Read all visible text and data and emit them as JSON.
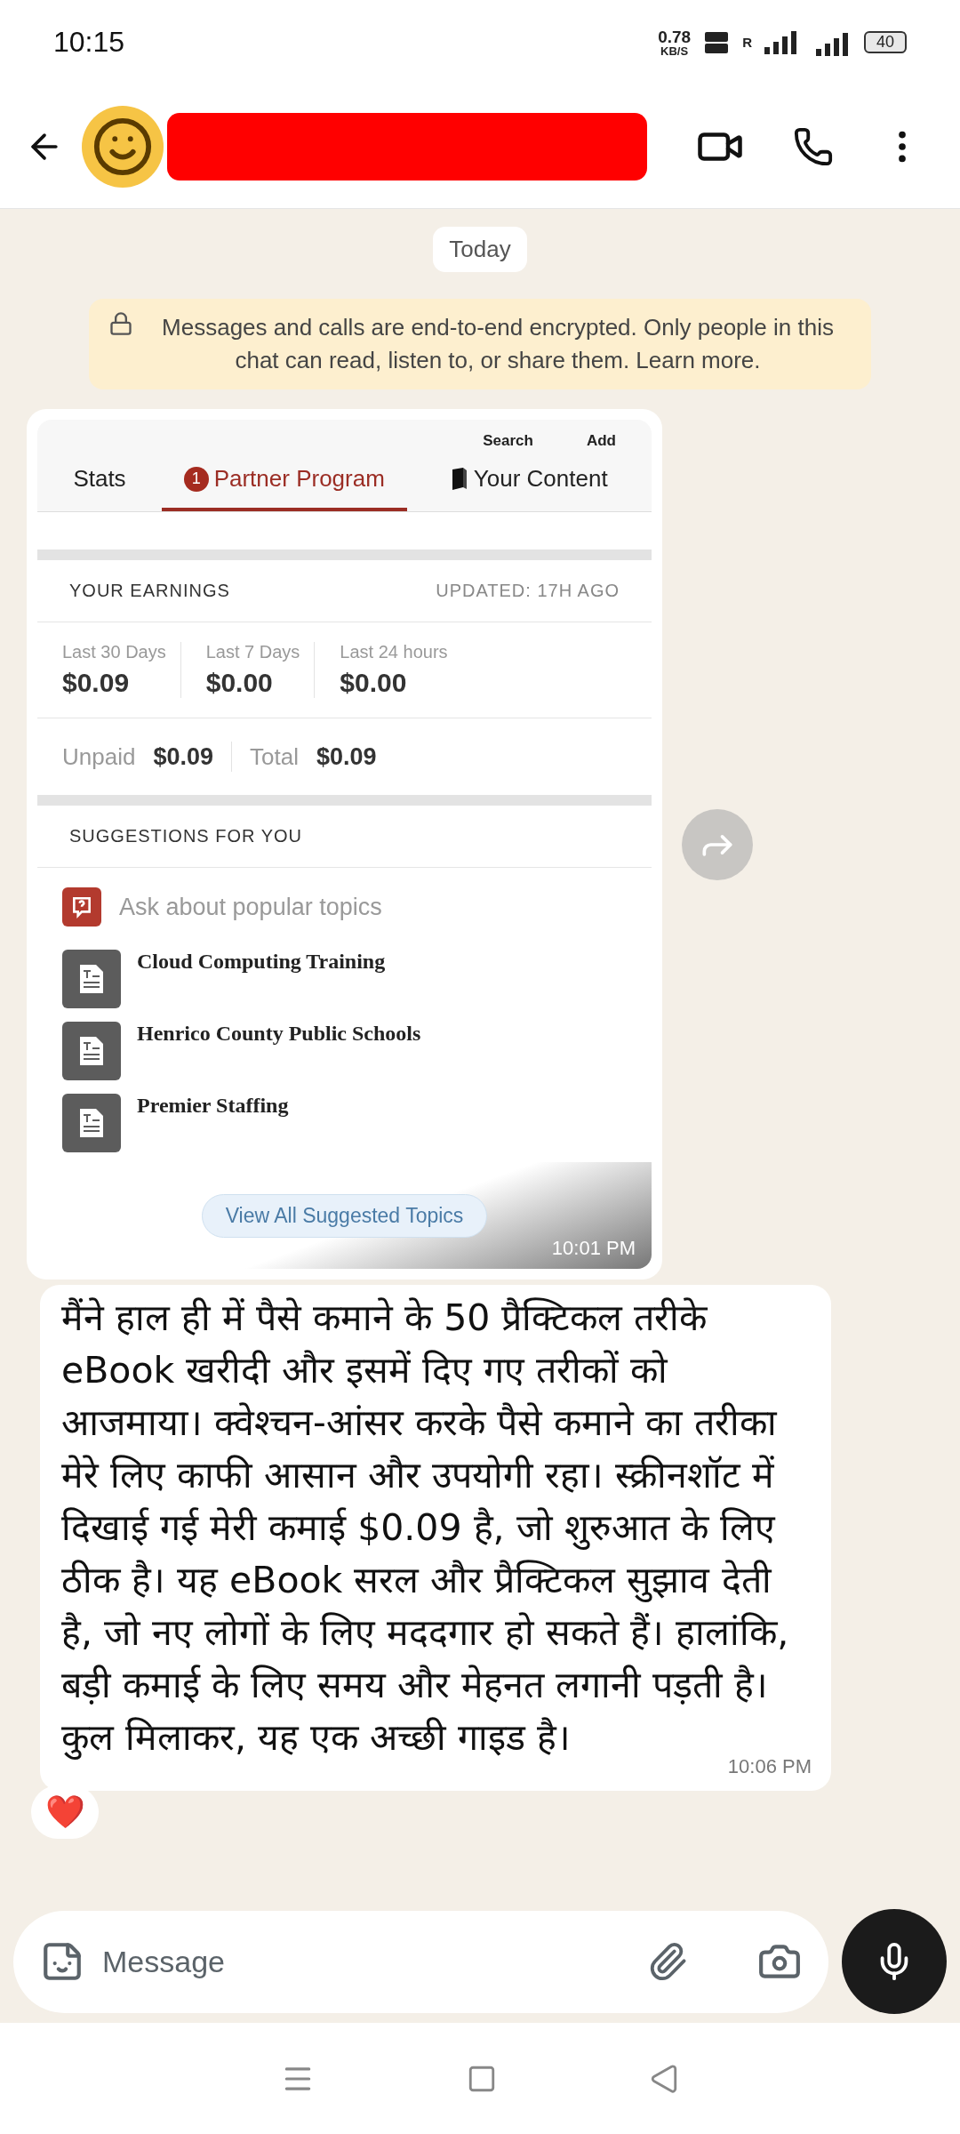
{
  "status_bar": {
    "time": "10:15",
    "speed_value": "0.78",
    "speed_unit": "KB/S",
    "roaming": "R",
    "battery": "40"
  },
  "header": {
    "redacted": true
  },
  "chat": {
    "date_chip": "Today",
    "encryption_notice": "Messages and calls are end-to-end encrypted. Only people in this chat can read, listen to, or share them. Learn more.",
    "messages": [
      {
        "kind": "image",
        "time": "10:01 PM",
        "screenshot": {
          "top_actions": [
            "Search",
            "Add"
          ],
          "tabs": [
            {
              "label": "Stats",
              "selected": false
            },
            {
              "label": "Partner Program",
              "selected": true,
              "badge": "1"
            },
            {
              "label": "Your Content",
              "selected": false
            }
          ],
          "earnings": {
            "title": "YOUR EARNINGS",
            "updated": "UPDATED: 17H AGO",
            "periods": [
              {
                "label": "Last 30 Days",
                "value": "$0.09"
              },
              {
                "label": "Last 7 Days",
                "value": "$0.00"
              },
              {
                "label": "Last 24 hours",
                "value": "$0.00"
              }
            ],
            "summary": [
              {
                "label": "Unpaid",
                "value": "$0.09"
              },
              {
                "label": "Total",
                "value": "$0.09"
              }
            ]
          },
          "suggestions": {
            "title": "SUGGESTIONS FOR YOU",
            "ask": "Ask about popular topics",
            "topics": [
              "Cloud Computing Training",
              "Henrico County Public Schools",
              "Premier Staffing"
            ],
            "button": "View All Suggested Topics"
          }
        }
      },
      {
        "kind": "text",
        "time": "10:06 PM",
        "reaction": "❤️",
        "text": "मैंने हाल ही में पैसे कमाने के 50 प्रैक्टिकल तरीके eBook खरीदी और इसमें दिए गए तरीकों को आजमाया। क्वेश्चन-आंसर करके पैसे कमाने का तरीका मेरे लिए काफी आसान और उपयोगी रहा। स्क्रीनशॉट में दिखाई गई मेरी कमाई $0.09 है, जो शुरुआत के लिए ठीक है। यह eBook सरल और प्रैक्टिकल सुझाव देती है, जो नए लोगों के लिए मददगार हो सकते हैं। हालांकि, बड़ी कमाई के लिए समय और मेहनत लगानी पड़ती है। कुल मिलाकर, यह एक अच्छी गाइड है।"
      }
    ]
  },
  "composer": {
    "placeholder": "Message"
  }
}
